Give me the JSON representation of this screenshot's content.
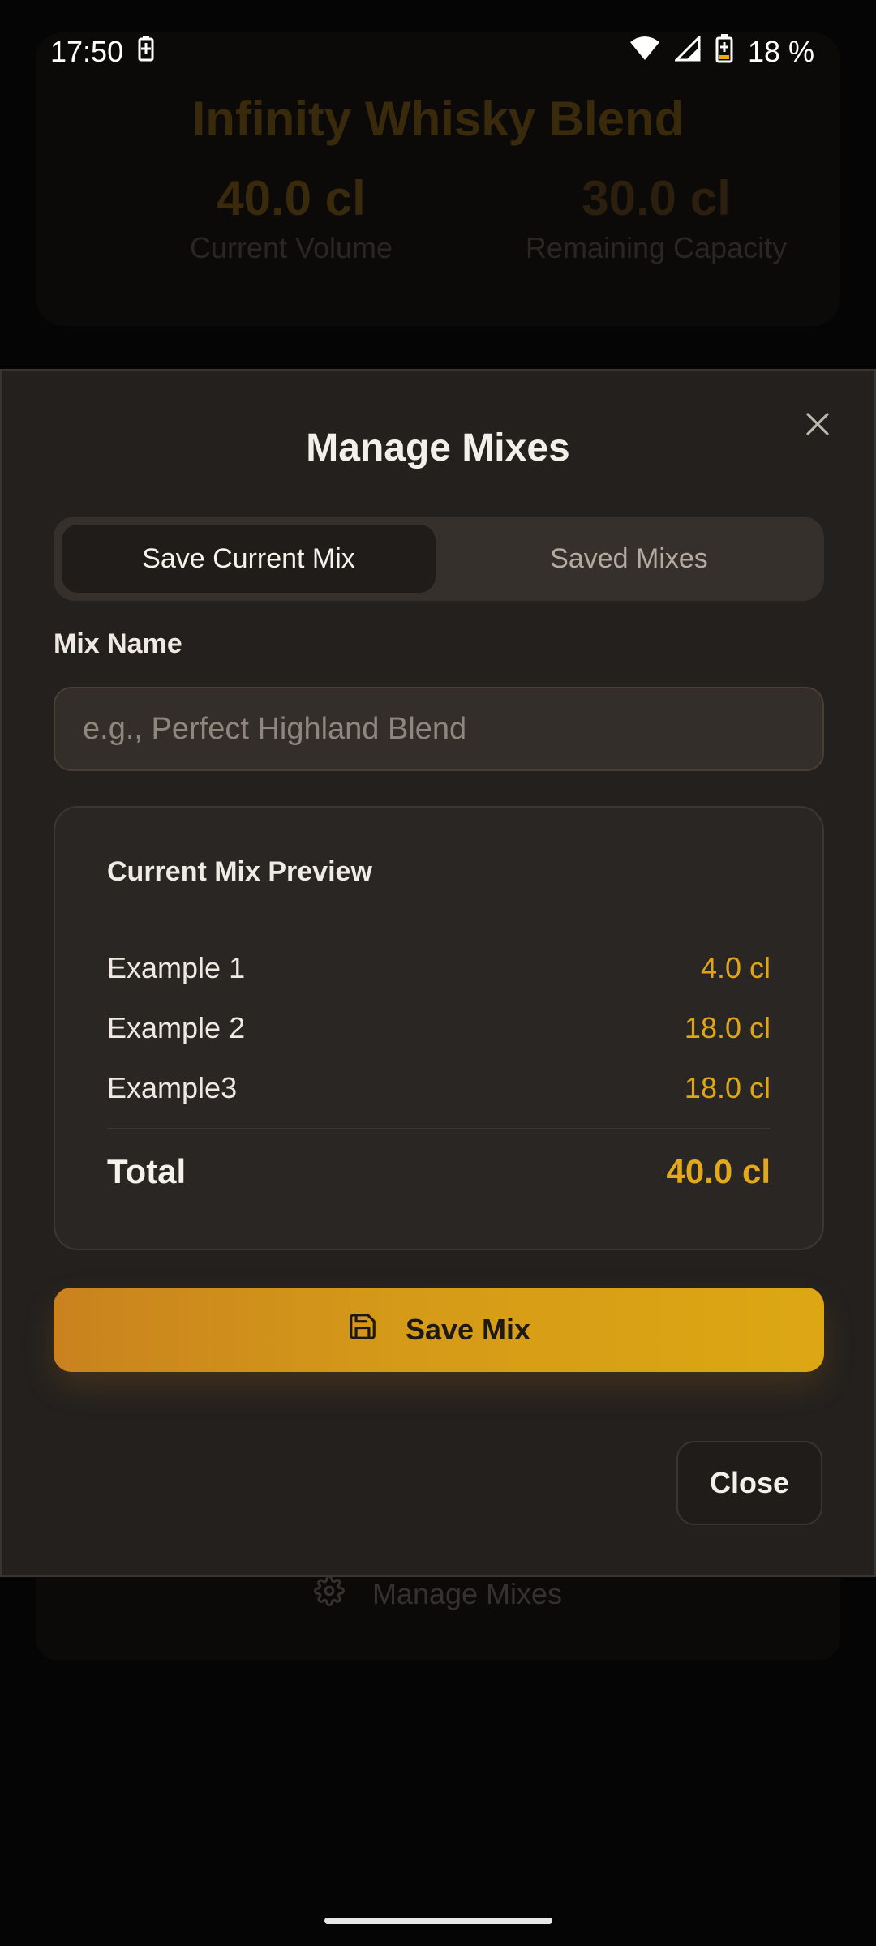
{
  "status_bar": {
    "time": "17:50",
    "battery_percent": "18 %",
    "icons": [
      "battery-charging-icon",
      "wifi-icon",
      "cell-signal-icon",
      "battery-icon"
    ]
  },
  "background": {
    "title": "Infinity Whisky Blend",
    "current_volume_value": "40.0 cl",
    "current_volume_label": "Current Volume",
    "remaining_value": "30.0 cl",
    "remaining_label": "Remaining Capacity",
    "manage_button_label": "Manage Mixes"
  },
  "sheet": {
    "title": "Manage Mixes",
    "tabs": [
      {
        "label": "Save Current Mix",
        "active": true
      },
      {
        "label": "Saved Mixes",
        "active": false
      }
    ],
    "mix_name_label": "Mix Name",
    "mix_name_value": "",
    "mix_name_placeholder": "e.g., Perfect Highland Blend",
    "preview": {
      "title": "Current Mix Preview",
      "items": [
        {
          "name": "Example 1",
          "amount": "4.0 cl"
        },
        {
          "name": "Example 2",
          "amount": "18.0 cl"
        },
        {
          "name": "Example3",
          "amount": "18.0 cl"
        }
      ],
      "total_label": "Total",
      "total_amount": "40.0 cl"
    },
    "save_button_label": "Save Mix",
    "close_button_label": "Close"
  },
  "colors": {
    "accent": "#dca713",
    "accent_start": "#c9821e",
    "sheet_bg": "#23201e",
    "page_bg": "#050505"
  }
}
